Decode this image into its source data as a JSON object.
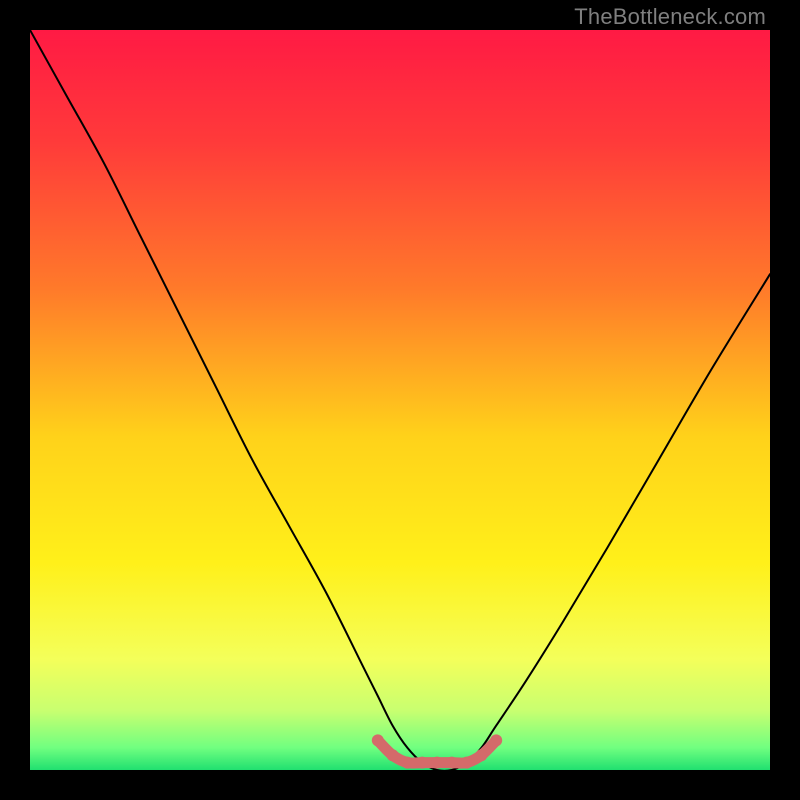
{
  "watermark": "TheBottleneck.com",
  "chart_data": {
    "type": "line",
    "title": "",
    "xlabel": "",
    "ylabel": "",
    "xlim": [
      0,
      100
    ],
    "ylim": [
      0,
      100
    ],
    "series": [
      {
        "name": "bottleneck-curve",
        "x": [
          0,
          5,
          10,
          15,
          20,
          25,
          30,
          35,
          40,
          45,
          47,
          49,
          51,
          53,
          55,
          57,
          59,
          61,
          63,
          67,
          72,
          78,
          85,
          92,
          100
        ],
        "values": [
          100,
          91,
          82,
          72,
          62,
          52,
          42,
          33,
          24,
          14,
          10,
          6,
          3,
          1,
          0,
          0,
          1,
          3,
          6,
          12,
          20,
          30,
          42,
          54,
          67
        ]
      },
      {
        "name": "flat-region-marker",
        "x": [
          47,
          49,
          51,
          53,
          55,
          57,
          59,
          61,
          63
        ],
        "values": [
          4,
          2,
          1,
          1,
          1,
          1,
          1,
          2,
          4
        ]
      }
    ],
    "gradient_stops": [
      {
        "pos": 0.0,
        "color": "#ff1a44"
      },
      {
        "pos": 0.15,
        "color": "#ff3a3a"
      },
      {
        "pos": 0.35,
        "color": "#ff7a2a"
      },
      {
        "pos": 0.55,
        "color": "#ffd21a"
      },
      {
        "pos": 0.72,
        "color": "#fff01a"
      },
      {
        "pos": 0.85,
        "color": "#f4ff5a"
      },
      {
        "pos": 0.92,
        "color": "#c8ff70"
      },
      {
        "pos": 0.97,
        "color": "#70ff80"
      },
      {
        "pos": 1.0,
        "color": "#20e070"
      }
    ],
    "flat_marker_color": "#d46a6a"
  }
}
